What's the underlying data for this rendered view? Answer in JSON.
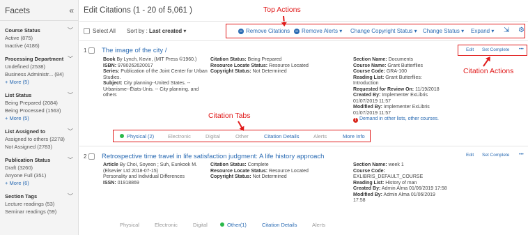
{
  "sidebar": {
    "title": "Facets",
    "collapse_glyph": "«",
    "groups": [
      {
        "title": "Course Status",
        "items": [
          "Active (875)",
          "Inactive (4186)"
        ],
        "more": ""
      },
      {
        "title": "Processing Department",
        "items": [
          "Undefined (2538)",
          "Business Administr... (84)"
        ],
        "more": "+ More (5)"
      },
      {
        "title": "List Status",
        "items": [
          "Being Prepared (2084)",
          "Being Processed (1563)"
        ],
        "more": "+ More (5)"
      },
      {
        "title": "List Assigned to",
        "items": [
          "Assigned to others (2278)",
          "Not Assigned (2783)"
        ],
        "more": ""
      },
      {
        "title": "Publication Status",
        "items": [
          "Draft (3260)",
          "Anyone Full (351)"
        ],
        "more": "+ More (6)"
      },
      {
        "title": "Section Tags",
        "items": [
          "Lecture readings (53)",
          "Seminar readings (59)"
        ],
        "more": ""
      }
    ]
  },
  "main": {
    "title": "Edit Citations (1 - 20 of 5,061 )",
    "toolbar": {
      "select_all": "Select All",
      "sort_prefix": "Sort by : ",
      "sort_value": "Last created",
      "sort_chevron": "▾",
      "remove_citations": "Remove Citations",
      "remove_alerts": "Remove Alerts ▾",
      "change_copyright": "Change Copyright Status ▾",
      "change_status": "Change Status ▾",
      "expand": "Expand ▾",
      "export_icon": "⇲",
      "gear_icon": "⚙"
    }
  },
  "annotations": {
    "top_actions": "Top Actions",
    "citation_actions": "Citation Actions",
    "citation_tabs": "Citation Tabs"
  },
  "citations": [
    {
      "num": "1",
      "title": "The image of the city /",
      "left": {
        "book_label": "Book",
        "book_value": " By Lynch, Kevin, (MIT Press ©1960.)",
        "isbn_label": "ISBN:",
        "isbn_value": " 9780262620017",
        "series_label": "Series:",
        "series_value": " Publication of the Joint Center for Urban Studies.",
        "subject_label": "Subject:",
        "subject_value": " City planning--United States. -- Urbanisme--États-Unis. -- City planning. and others"
      },
      "mid": {
        "status_label": "Citation Status:",
        "status_value": " Being Prepared",
        "resource_label": "Resource Locate Status:",
        "resource_value": " Resource Located",
        "copyright_label": "Copyright Status:",
        "copyright_value": " Not Determined"
      },
      "right": {
        "section_label": "Section Name:",
        "section_value": " Documents",
        "course_label": "Course Name:",
        "course_value": " Grant Butterflies",
        "code_label": "Course Code:",
        "code_value": " GRA-100",
        "reading_label": "Reading List:",
        "reading_value": " Grant Butterflies: Introduction",
        "review_label": "Requested for Review On:",
        "review_value": " 11/19/2018",
        "created_label": "Created By:",
        "created_value": " Implementer ExLibris 01/07/2019 11:57",
        "modified_label": "Modified By:",
        "modified_value": " Implementer ExLibris 01/07/2019 11:57",
        "demand": "Demand in other lists, other courses."
      },
      "actions": {
        "edit": "Edit",
        "set_complete": "Set Complete",
        "more": "•••"
      },
      "tabs": [
        "Physical (2)",
        "Electronic",
        "Digital",
        "Other",
        "Citation Details",
        "Alerts",
        "More Info"
      ]
    },
    {
      "num": "2",
      "title": "Retrospective time travel in life satisfaction judgment: A life history approach",
      "left": {
        "article_label": "Article",
        "article_value": " By Choi, Soyeon ; Suh, Eunkook M. (Elsevier Ltd 2018-07-15)",
        "journal": "Personality and Individual Differences",
        "issn_label": "ISSN:",
        "issn_value": " 01918869"
      },
      "mid": {
        "status_label": "Citation Status:",
        "status_value": " Complete",
        "resource_label": "Resource Locate Status:",
        "resource_value": " Resource Located",
        "copyright_label": "Copyright Status:",
        "copyright_value": " Not Determined"
      },
      "right": {
        "section_label": "Section Name:",
        "section_value": " week 1",
        "code_label": "Course Code:",
        "code_value": " EXLIBRIS_DEFAULT_COURSE",
        "reading_label": "Reading List:",
        "reading_value": " History of man",
        "created_label": "Created By:",
        "created_value": " Admin Alma 01/06/2019 17:58",
        "modified_label": "Modified By:",
        "modified_value": " Admin Alma 01/06/2019 17:58"
      },
      "actions": {
        "edit": "Edit",
        "set_complete": "Set Complete",
        "more": "•••"
      },
      "tabs": [
        "Physical",
        "Electronic",
        "Digital",
        "Other(1)",
        "Citation Details",
        "Alerts"
      ]
    }
  ]
}
